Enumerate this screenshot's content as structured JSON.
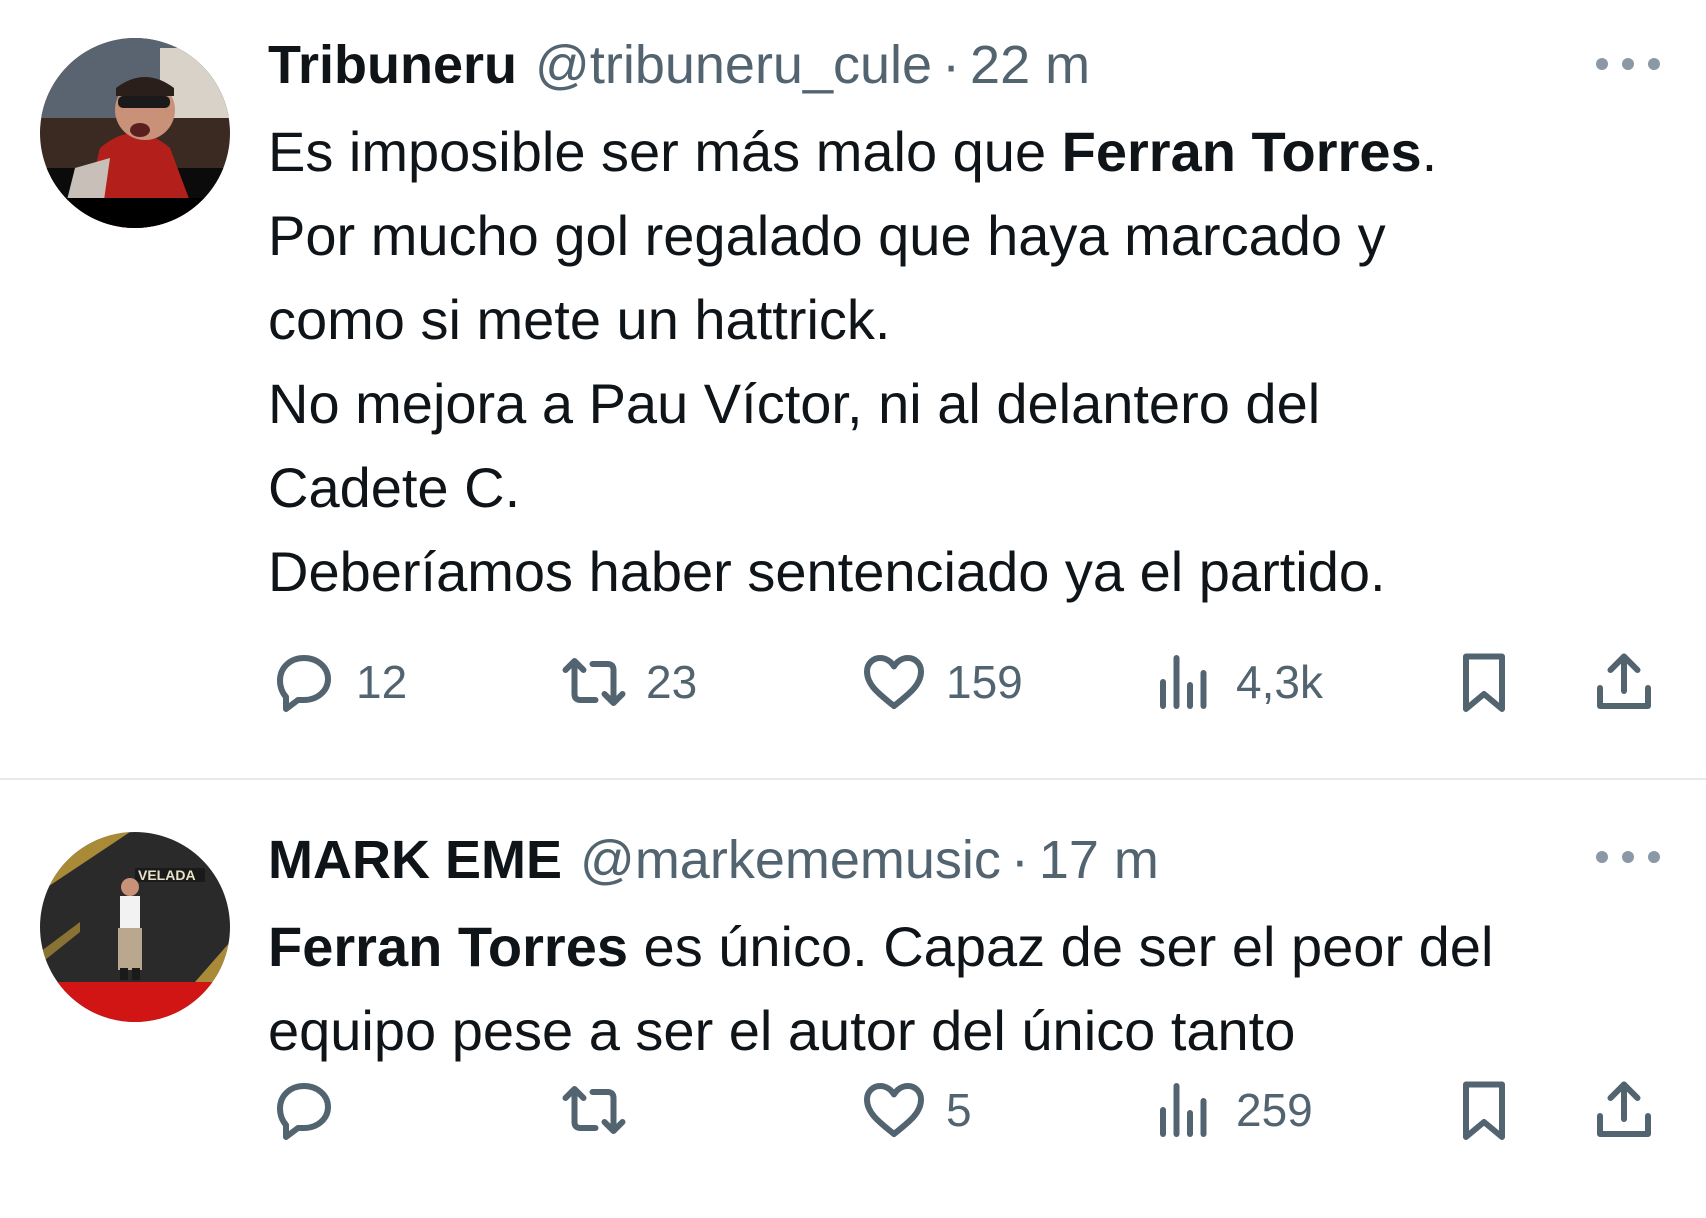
{
  "colors": {
    "text": "#0f1419",
    "secondary": "#536471",
    "divider": "#e6e9eb"
  },
  "tweets": [
    {
      "display_name": "Tribuneru",
      "handle": "@tribuneru_cule",
      "separator": "·",
      "time": "22 m",
      "more_icon": "ellipsis-icon",
      "text_lines": [
        {
          "before": "Es imposible ser más malo que ",
          "bold": "Ferran Torres",
          "after": "."
        },
        {
          "before": "Por mucho gol regalado que haya marcado y",
          "bold": "",
          "after": ""
        },
        {
          "before": "como si mete un hattrick.",
          "bold": "",
          "after": ""
        },
        {
          "before": "No mejora a Pau Víctor, ni al delantero del",
          "bold": "",
          "after": ""
        },
        {
          "before": "Cadete C.",
          "bold": "",
          "after": ""
        },
        {
          "before": "Deberíamos haber sentenciado ya el partido.",
          "bold": "",
          "after": ""
        }
      ],
      "stats": {
        "replies": "12",
        "retweets": "23",
        "likes": "159",
        "views": "4,3k"
      }
    },
    {
      "display_name": "MARK EME",
      "handle": "@markememusic",
      "separator": "·",
      "time": "17 m",
      "more_icon": "ellipsis-icon",
      "avatar_sign_text": "VELADA",
      "text_lines": [
        {
          "before": "",
          "bold": "Ferran Torres",
          "after": " es único. Capaz de ser el peor del"
        },
        {
          "before": "equipo pese a ser el autor del único tanto",
          "bold": "",
          "after": ""
        }
      ],
      "stats": {
        "replies": "",
        "retweets": "",
        "likes": "5",
        "views": "259"
      }
    }
  ]
}
